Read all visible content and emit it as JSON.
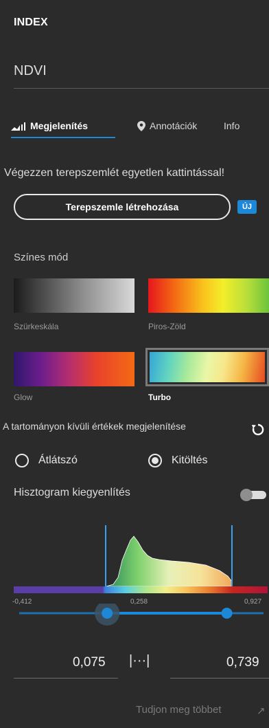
{
  "panel": {
    "title": "INDEX",
    "index_value": "NDVI"
  },
  "tabs": [
    {
      "label": "Megjelenítés",
      "icon": "chart-bars-icon",
      "active": true
    },
    {
      "label": "Annotációk",
      "icon": "location-pin-icon",
      "active": false
    },
    {
      "label": "Info",
      "active": false
    }
  ],
  "promo": {
    "text": "Végezzen terepszemlét egyetlen kattintással!",
    "button_label": "Terepszemle létrehozása",
    "badge": "ÚJ"
  },
  "color_mode": {
    "label": "Színes mód",
    "options": [
      {
        "label": "Szürkeskála",
        "selected": false
      },
      {
        "label": "Piros-Zöld",
        "selected": false
      },
      {
        "label": "Glow",
        "selected": false
      },
      {
        "label": "Turbo",
        "selected": true
      }
    ]
  },
  "out_of_range": {
    "label": "A tartományon kívüli értékek megjelenítése",
    "options": [
      {
        "label": "Átlátszó",
        "selected": false
      },
      {
        "label": "Kitöltés",
        "selected": true
      }
    ]
  },
  "histogram": {
    "label": "Hisztogram kiegyenlítés",
    "equalization_enabled": false,
    "min_label": "-0,412",
    "mid_label": "0,258",
    "max_label": "0,927"
  },
  "range": {
    "low": "0,075",
    "link_symbol": "|···|",
    "high": "0,739",
    "low_fraction": 0.36,
    "high_fraction": 0.85
  },
  "footer": {
    "learn_more": "Tudjon meg többet",
    "arrow": "↗"
  },
  "colors": {
    "accent": "#1e88d8",
    "background": "#2b2b2b",
    "text": "#e6e6e6"
  }
}
